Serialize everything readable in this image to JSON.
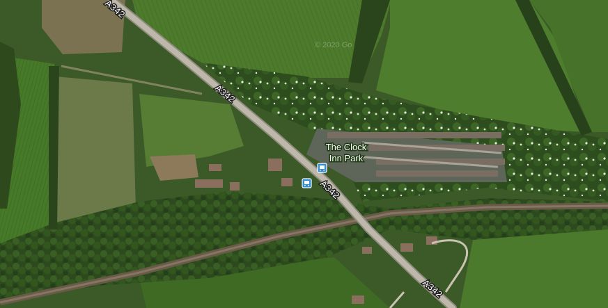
{
  "map": {
    "view": "satellite",
    "road_labels": [
      "A342",
      "A342",
      "A342",
      "A342"
    ],
    "places": [
      {
        "name_line1": "The Clock",
        "name_line2": "Inn Park"
      }
    ],
    "watermark": "© 2020 Go",
    "icons": [
      "bus-stop-icon",
      "bus-stop-icon"
    ],
    "colors": {
      "road": "#b9b4a6",
      "field_light": "#4f7a2c",
      "field_dark": "#2f5a1c",
      "woodland": "#2c4a1d",
      "bus_stop": "#2f8fd8",
      "label_text": "#ffffff"
    }
  }
}
